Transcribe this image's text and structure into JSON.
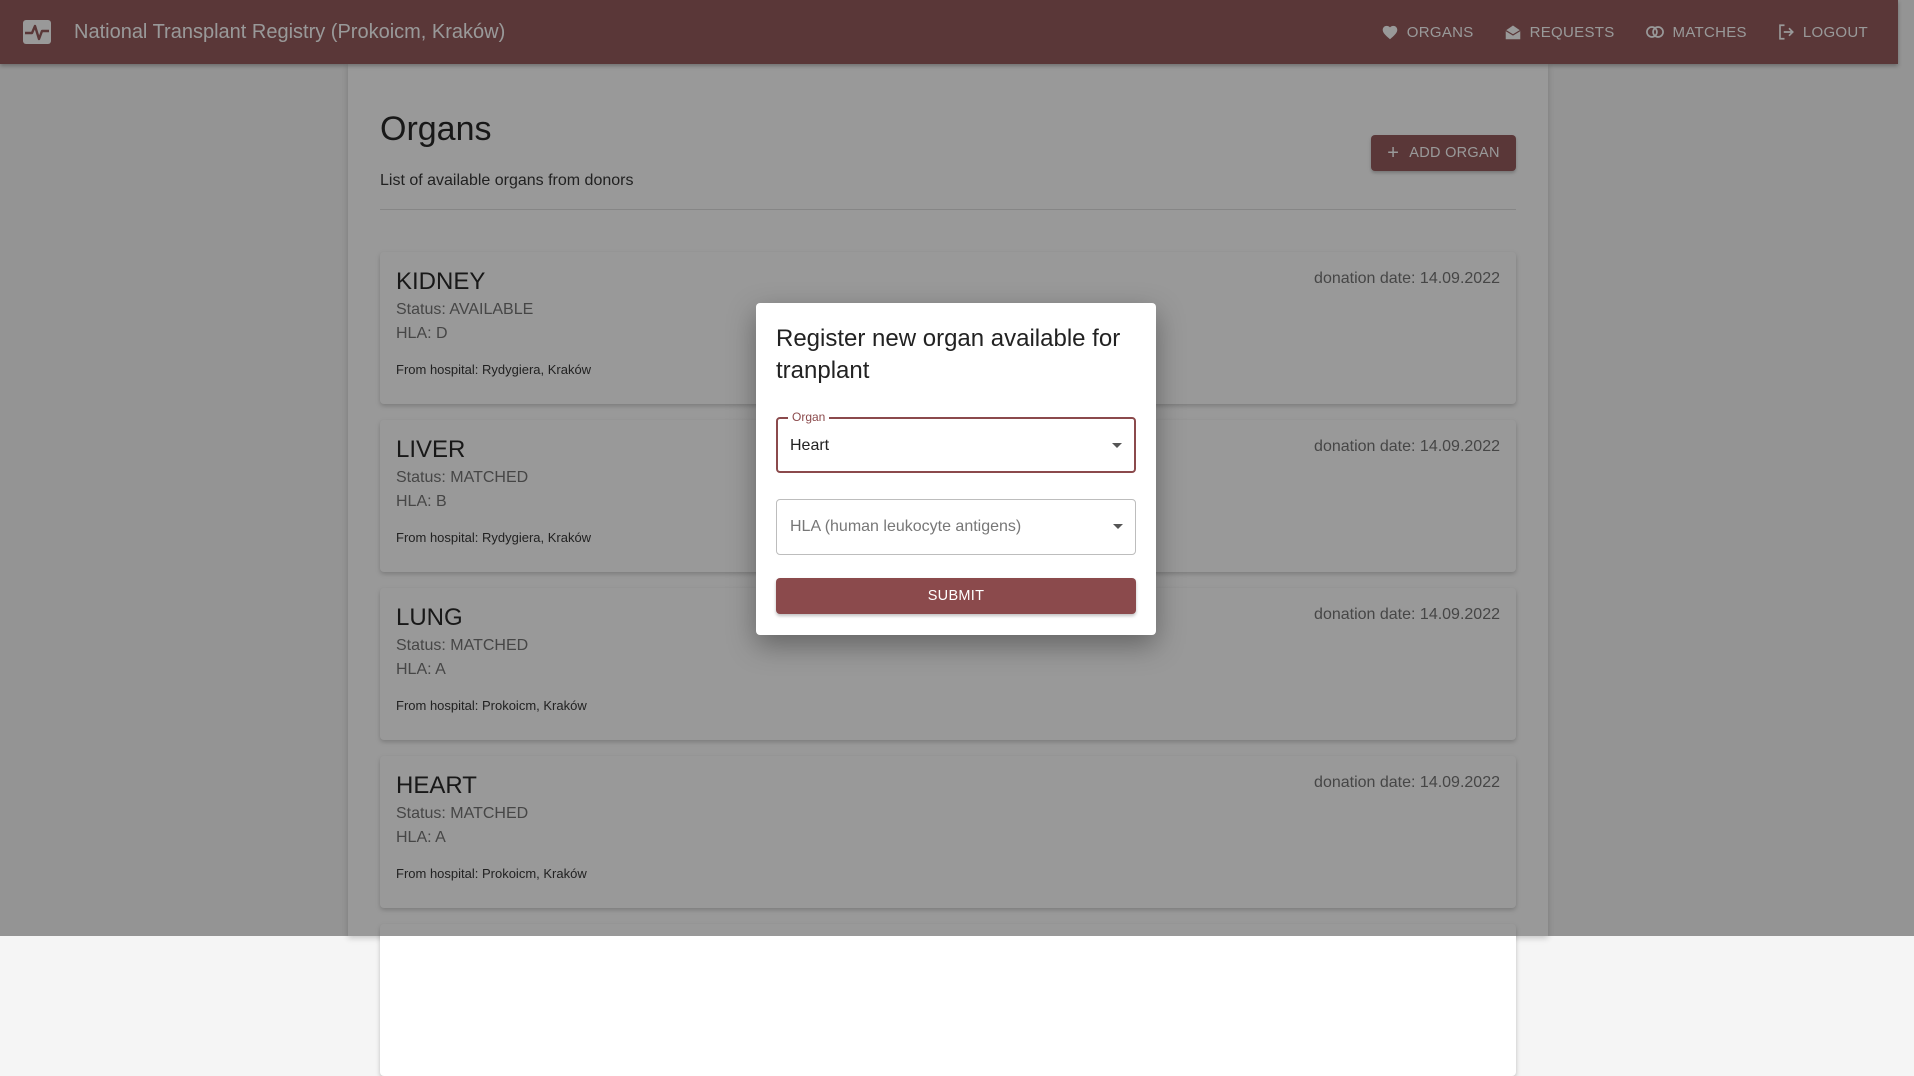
{
  "header": {
    "title": "National Transplant Registry (Prokoicm, Kraków)",
    "logo_icon": "heartbeat-monitor-icon",
    "nav": [
      {
        "label": "ORGANS",
        "icon": "heart-icon"
      },
      {
        "label": "REQUESTS",
        "icon": "inbox-open-icon"
      },
      {
        "label": "MATCHES",
        "icon": "match-rings-icon"
      },
      {
        "label": "LOGOUT",
        "icon": "logout-icon"
      }
    ]
  },
  "page": {
    "title": "Organs",
    "subtitle": "List of available organs from donors",
    "add_button": "ADD ORGAN"
  },
  "organs": [
    {
      "name": "KIDNEY",
      "status": "Status: AVAILABLE",
      "hla": "HLA: D",
      "hospital": "From hospital: Rydygiera, Kraków",
      "date": "donation date: 14.09.2022"
    },
    {
      "name": "LIVER",
      "status": "Status: MATCHED",
      "hla": "HLA: B",
      "hospital": "From hospital: Rydygiera, Kraków",
      "date": "donation date: 14.09.2022"
    },
    {
      "name": "LUNG",
      "status": "Status: MATCHED",
      "hla": "HLA: A",
      "hospital": "From hospital: Prokoicm, Kraków",
      "date": "donation date: 14.09.2022"
    },
    {
      "name": "HEART",
      "status": "Status: MATCHED",
      "hla": "HLA: A",
      "hospital": "From hospital: Prokoicm, Kraków",
      "date": "donation date: 14.09.2022"
    }
  ],
  "dialog": {
    "title": "Register new organ available for tranplant",
    "organ_label": "Organ",
    "organ_value": "Heart",
    "hla_placeholder": "HLA (human leukocyte antigens)",
    "submit": "SUBMIT"
  },
  "colors": {
    "primary": "#8b4a4c",
    "overlay": "rgba(33,33,33,0.46)"
  }
}
